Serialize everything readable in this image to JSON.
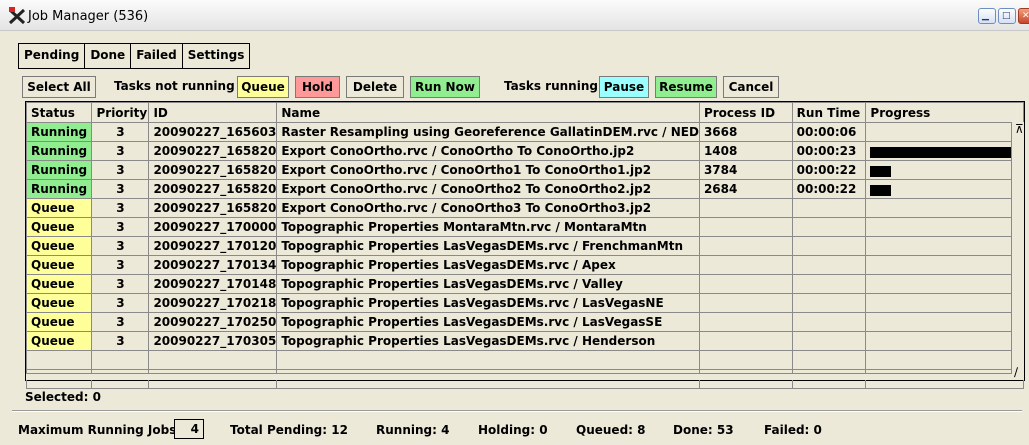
{
  "window": {
    "title": "Job Manager (536)",
    "icon": "tnt-app-icon"
  },
  "tabs": [
    "Pending",
    "Done",
    "Failed",
    "Settings"
  ],
  "toolbar": {
    "select_all": "Select All",
    "not_running_label": "Tasks not running",
    "queue": "Queue",
    "hold": "Hold",
    "delete": "Delete",
    "run_now": "Run Now",
    "running_label": "Tasks running",
    "pause": "Pause",
    "resume": "Resume",
    "cancel": "Cancel",
    "colors": {
      "queue": "#ffff99",
      "hold": "#ff9999",
      "run_now": "#90ee90",
      "pause": "#99ffff",
      "resume": "#90ee90"
    }
  },
  "table": {
    "columns": [
      "Status",
      "Priority",
      "ID",
      "Name",
      "Process ID",
      "Run Time",
      "Progress"
    ],
    "rows": [
      {
        "status": "Running",
        "priority": "3",
        "id": "20090227_165603",
        "name": "Raster Resampling using Georeference GallatinDEM.rvc / NED",
        "pid": "3668",
        "runtime": "00:00:06",
        "progress": 0
      },
      {
        "status": "Running",
        "priority": "3",
        "id": "20090227_165820",
        "name": "Export ConoOrtho.rvc / ConoOrtho To ConoOrtho.jp2",
        "pid": "1408",
        "runtime": "00:00:23",
        "progress": 0.98
      },
      {
        "status": "Running",
        "priority": "3",
        "id": "20090227_165820",
        "name": "Export ConoOrtho.rvc / ConoOrtho1 To ConoOrtho1.jp2",
        "pid": "3784",
        "runtime": "00:00:22",
        "progress": 0.14
      },
      {
        "status": "Running",
        "priority": "3",
        "id": "20090227_165820",
        "name": "Export ConoOrtho.rvc / ConoOrtho2 To ConoOrtho2.jp2",
        "pid": "2684",
        "runtime": "00:00:22",
        "progress": 0.14
      },
      {
        "status": "Queue",
        "priority": "3",
        "id": "20090227_165820",
        "name": "Export ConoOrtho.rvc / ConoOrtho3 To ConoOrtho3.jp2",
        "pid": "",
        "runtime": "",
        "progress": null
      },
      {
        "status": "Queue",
        "priority": "3",
        "id": "20090227_170000",
        "name": "Topographic Properties MontaraMtn.rvc / MontaraMtn",
        "pid": "",
        "runtime": "",
        "progress": null
      },
      {
        "status": "Queue",
        "priority": "3",
        "id": "20090227_170120",
        "name": "Topographic Properties LasVegasDEMs.rvc / FrenchmanMtn",
        "pid": "",
        "runtime": "",
        "progress": null
      },
      {
        "status": "Queue",
        "priority": "3",
        "id": "20090227_170134",
        "name": "Topographic Properties LasVegasDEMs.rvc / Apex",
        "pid": "",
        "runtime": "",
        "progress": null
      },
      {
        "status": "Queue",
        "priority": "3",
        "id": "20090227_170148",
        "name": "Topographic Properties LasVegasDEMs.rvc / Valley",
        "pid": "",
        "runtime": "",
        "progress": null
      },
      {
        "status": "Queue",
        "priority": "3",
        "id": "20090227_170218",
        "name": "Topographic Properties LasVegasDEMs.rvc / LasVegasNE",
        "pid": "",
        "runtime": "",
        "progress": null
      },
      {
        "status": "Queue",
        "priority": "3",
        "id": "20090227_170250",
        "name": "Topographic Properties LasVegasDEMs.rvc / LasVegasSE",
        "pid": "",
        "runtime": "",
        "progress": null
      },
      {
        "status": "Queue",
        "priority": "3",
        "id": "20090227_170305",
        "name": "Topographic Properties LasVegasDEMs.rvc / Henderson",
        "pid": "",
        "runtime": "",
        "progress": null
      }
    ],
    "status_colors": {
      "Running": "#90ee90",
      "Queue": "#ffff99"
    }
  },
  "selected": "Selected: 0",
  "footer": {
    "max_running_label": "Maximum Running Jobs",
    "max_running_value": "4",
    "total_pending": "Total Pending: 12",
    "running": "Running: 4",
    "holding": "Holding: 0",
    "queued": "Queued: 8",
    "done": "Done: 53",
    "failed": "Failed: 0"
  }
}
